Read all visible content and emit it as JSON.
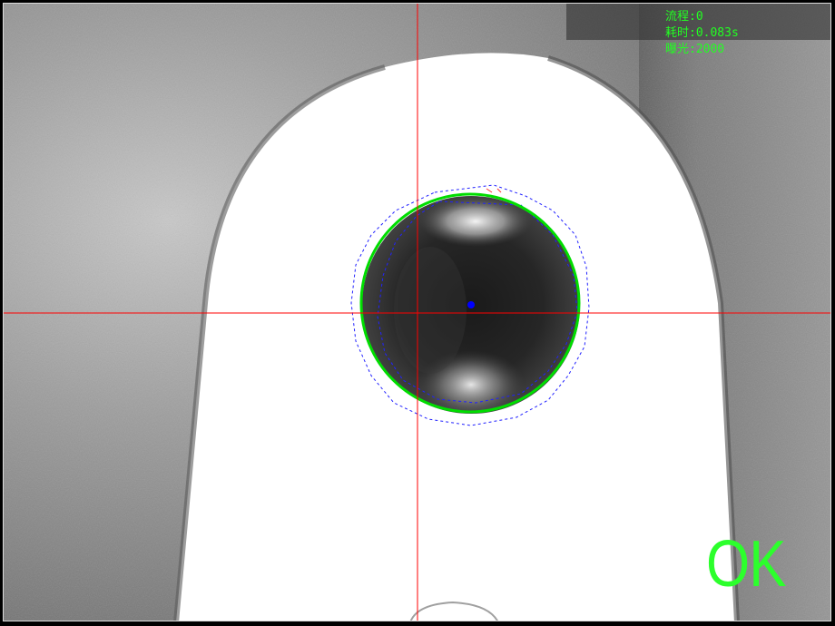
{
  "overlay": {
    "process_label": "流程:0",
    "time_label": "耗时:0.083s",
    "exposure_label": "曝光:2000"
  },
  "result": {
    "text": "OK"
  },
  "colors": {
    "crosshair": "#ff0000",
    "circle_fit": "#00dd00",
    "search_region": "#2222ff",
    "center_marker": "#0000ff",
    "status_text": "#22ff22"
  }
}
